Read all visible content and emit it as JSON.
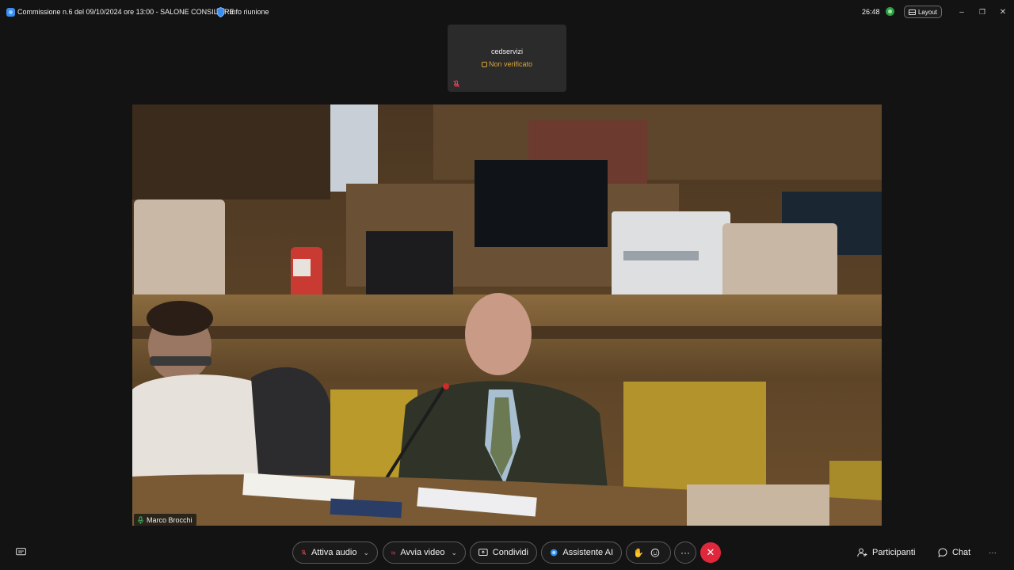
{
  "titlebar": {
    "meeting_title": "Commissione n.6 del 09/10/2024 ore 13:00 - SALONE CONSILIARE",
    "info_label": "Info riunione",
    "timer": "26:48",
    "layout_label": "Layout",
    "minimize_glyph": "–",
    "restore_glyph": "❐",
    "close_glyph": "✕",
    "icons": {
      "app": "app-logo-icon",
      "info": "shield-icon",
      "status": "status-dot-icon",
      "layout": "layout-icon"
    }
  },
  "participant_tile": {
    "name": "cedservizi",
    "status": "Non verificato",
    "status_color": "#d9a53a",
    "mic_state": "muted"
  },
  "main_video": {
    "speaker_name": "Marco Brocchi",
    "mic_state": "on"
  },
  "toolbar": {
    "audio_label": "Attiva audio",
    "video_label": "Avvia video",
    "share_label": "Condividi",
    "ai_label": "Assistente AI",
    "more_glyph": "···",
    "end_glyph": "✕",
    "participants_label": "Participanti",
    "chat_label": "Chat",
    "overflow_glyph": "···",
    "end_color": "#e0283d"
  }
}
